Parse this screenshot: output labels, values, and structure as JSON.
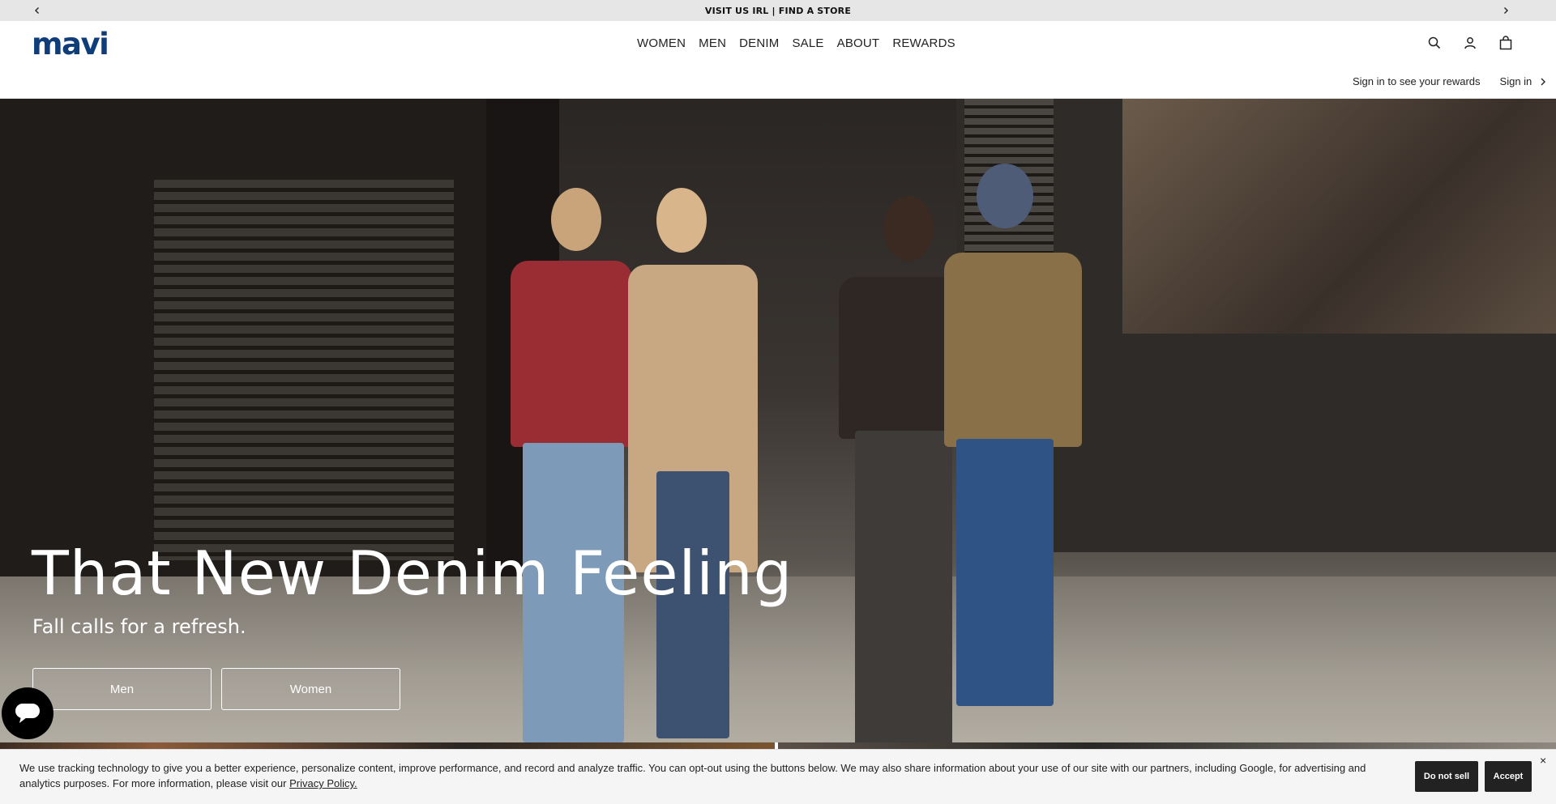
{
  "announcement": {
    "text": "VISIT US IRL | FIND A STORE",
    "prev_icon": "chevron-left-icon",
    "next_icon": "chevron-right-icon"
  },
  "header": {
    "logo": "mavi",
    "brand_color": "#0f3d7a",
    "nav": [
      "WOMEN",
      "MEN",
      "DENIM",
      "SALE",
      "ABOUT",
      "REWARDS"
    ],
    "icons": [
      "search-icon",
      "account-icon",
      "bag-icon"
    ],
    "rewards_text": "Sign in to see your rewards",
    "signin_label": "Sign in"
  },
  "hero": {
    "title": "That New Denim Feeling",
    "subtitle": "Fall calls for a refresh.",
    "buttons": {
      "men": "Men",
      "women": "Women"
    }
  },
  "chat": {
    "icon": "chat-bubble-icon"
  },
  "cookie": {
    "message": "We use tracking technology to give you a better experience, personalize content, improve performance, and record and analyze traffic. You can opt-out using the buttons below. We may also share information about your use of our site with our partners, including Google, for advertising and analytics purposes. For more information, please visit our ",
    "policy_link": "Privacy Policy.",
    "do_not_sell": "Do not sell",
    "accept": "Accept",
    "close": "×"
  }
}
